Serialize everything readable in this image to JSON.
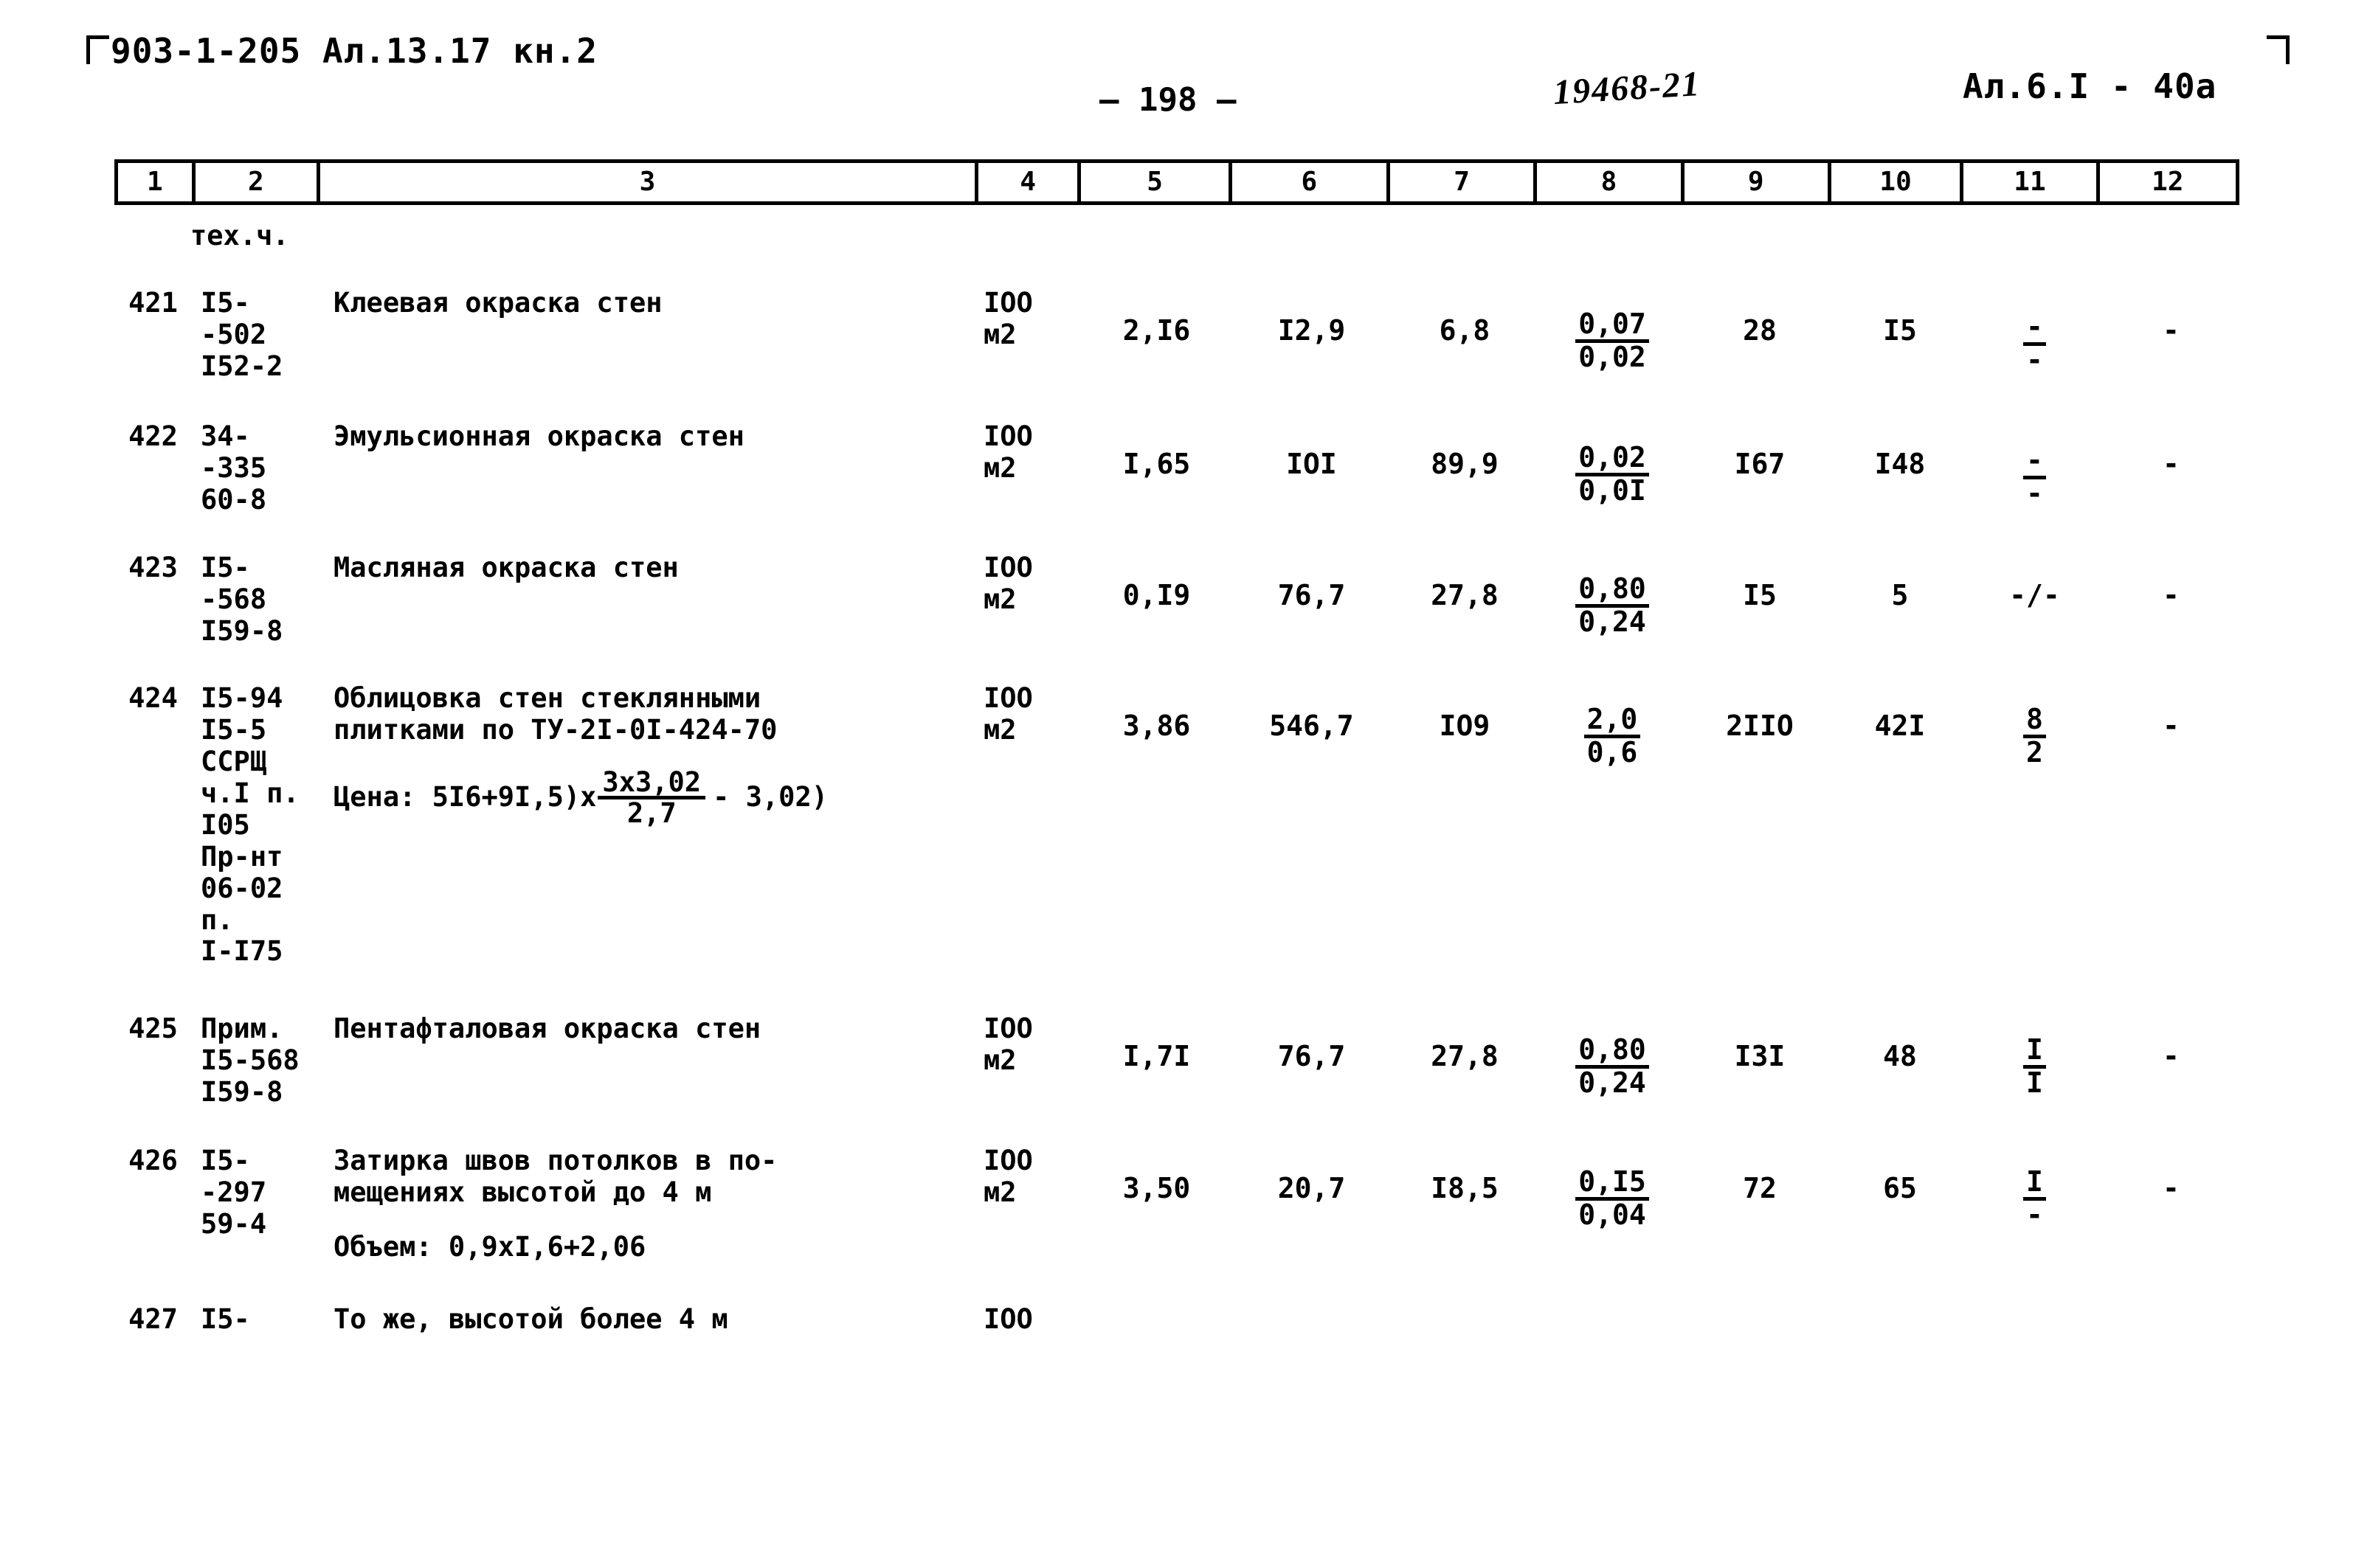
{
  "header": {
    "left_ref": "903-1-205 Ал.13.17 кн.2",
    "page_number": "— 198 —",
    "stamp": "19468-21",
    "right_ref": "Ал.6.I - 40а"
  },
  "column_numbers": [
    "1",
    "2",
    "3",
    "4",
    "5",
    "6",
    "7",
    "8",
    "9",
    "10",
    "11",
    "12"
  ],
  "notes": {
    "tech_ch": "тех.ч."
  },
  "rows": [
    {
      "num": "421",
      "code": "I5-\n-502\nI52-2",
      "description": "Клеевая окраска стен",
      "unit": "IOO\nм2",
      "c5": "2,I6",
      "c6": "I2,9",
      "c7": "6,8",
      "c8_top": "0,07",
      "c8_bot": "0,02",
      "c9": "28",
      "c10": "I5",
      "c11_top": "-",
      "c11_bot": "-",
      "c11_style": "fraction",
      "c12": "-"
    },
    {
      "num": "422",
      "code": "34-\n-335\n60-8",
      "description": "Эмульсионная окраска стен",
      "unit": "IOO\nм2",
      "c5": "I,65",
      "c6": "IOI",
      "c7": "89,9",
      "c8_top": "0,02",
      "c8_bot": "0,0I",
      "c9": "I67",
      "c10": "I48",
      "c11_top": "-",
      "c11_bot": "-",
      "c11_style": "fraction",
      "c12": "-"
    },
    {
      "num": "423",
      "code": "I5-\n-568\nI59-8",
      "description": "Масляная окраска стен",
      "unit": "IOO\nм2",
      "c5": "0,I9",
      "c6": "76,7",
      "c7": "27,8",
      "c8_top": "0,80",
      "c8_bot": "0,24",
      "c9": "I5",
      "c10": "5",
      "c11_inline": "-/-",
      "c11_style": "inline",
      "c12": "-"
    },
    {
      "num": "424",
      "code": "I5-94\nI5-5\nССРЩ\nч.I п.\nI05\nПр-нт\n06-02\nп.\nI-I75",
      "description": "Облицовка стен стеклянными\nплитками по ТУ-2I-0I-424-70",
      "unit": "IOO\nм2",
      "c5": "3,86",
      "c6": "546,7",
      "c7": "IO9",
      "c8_top": "2,0",
      "c8_bot": "0,6",
      "c9": "2IIO",
      "c10": "42I",
      "c11_top": "8",
      "c11_bot": "2",
      "c11_style": "fraction",
      "c12": "-",
      "formula": {
        "prefix": "Цена: 5I6+9I,5)x",
        "frac_top": "3x3,02",
        "frac_bot": "2,7",
        "suffix": "- 3,02)"
      }
    },
    {
      "num": "425",
      "code": "Прим.\nI5-568\nI59-8",
      "description": "Пентафталовая окраска стен",
      "unit": "IOO\nм2",
      "c5": "I,7I",
      "c6": "76,7",
      "c7": "27,8",
      "c8_top": "0,80",
      "c8_bot": "0,24",
      "c9": "I3I",
      "c10": "48",
      "c11_top": "I",
      "c11_bot": "I",
      "c11_style": "fraction",
      "c12": "-"
    },
    {
      "num": "426",
      "code": "I5-\n-297\n59-4",
      "description": "Затирка швов потолков в по-\nмещениях высотой до 4 м",
      "unit": "IOO\nм2",
      "c5": "3,50",
      "c6": "20,7",
      "c7": "I8,5",
      "c8_top": "0,I5",
      "c8_bot": "0,04",
      "c9": "72",
      "c10": "65",
      "c11_top": "I",
      "c11_bot": "-",
      "c11_style": "fraction",
      "c12": "-",
      "volume_note": "Объем: 0,9xI,6+2,06"
    },
    {
      "num": "427",
      "code": "I5-",
      "description": "То же, высотой более 4 м",
      "unit": "IOO",
      "c5": "",
      "c6": "",
      "c7": "",
      "c8_top": "",
      "c8_bot": "",
      "c9": "",
      "c10": "",
      "c11_style": "none",
      "c12": ""
    }
  ]
}
